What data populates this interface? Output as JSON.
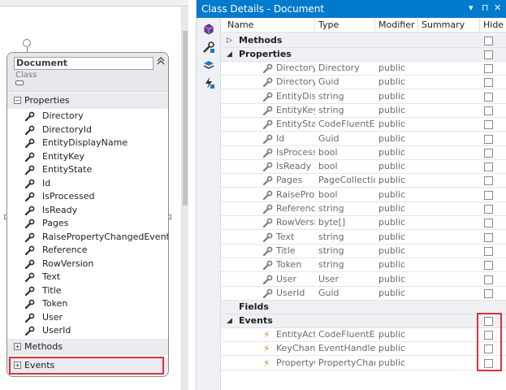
{
  "shape": {
    "class_name": "Document",
    "stereotype": "Class",
    "collapse_glyph": "«",
    "sections": {
      "properties": {
        "label": "Properties",
        "toggle": "−"
      },
      "methods": {
        "label": "Methods",
        "toggle": "+"
      },
      "events": {
        "label": "Events",
        "toggle": "+"
      }
    },
    "properties": [
      "Directory",
      "DirectoryId",
      "EntityDisplayName",
      "EntityKey",
      "EntityState",
      "Id",
      "IsProcessed",
      "IsReady",
      "Pages",
      "RaisePropertyChangedEvents",
      "Reference",
      "RowVersion",
      "Text",
      "Title",
      "Token",
      "User",
      "UserId"
    ],
    "icon": "wrench-icon"
  },
  "details": {
    "title": "Class Details - Document",
    "title_buttons": [
      "▾",
      "⊓",
      "✕"
    ],
    "tool_icons": [
      "new-method-icon",
      "new-property-icon",
      "new-field-icon",
      "new-event-icon"
    ],
    "columns": [
      "Name",
      "Type",
      "Modifier",
      "Summary",
      "Hide"
    ],
    "groups": {
      "methods": "Methods",
      "properties": "Properties",
      "fields": "Fields",
      "events": "Events"
    },
    "properties": [
      {
        "name": "Directory",
        "type": "Directory",
        "modifier": "public"
      },
      {
        "name": "DirectoryId",
        "type": "Guid",
        "modifier": "public"
      },
      {
        "name": "EntityDisplay",
        "type": "string",
        "modifier": "public"
      },
      {
        "name": "EntityKey",
        "type": "string",
        "modifier": "public"
      },
      {
        "name": "EntityState",
        "type": "CodeFluentEnti",
        "modifier": "public"
      },
      {
        "name": "Id",
        "type": "Guid",
        "modifier": "public"
      },
      {
        "name": "IsProcessed",
        "type": "bool",
        "modifier": "public"
      },
      {
        "name": "IsReady",
        "type": "bool",
        "modifier": "public"
      },
      {
        "name": "Pages",
        "type": "PageCollection",
        "modifier": "public"
      },
      {
        "name": "RaisePropert",
        "type": "bool",
        "modifier": "public"
      },
      {
        "name": "Reference",
        "type": "string",
        "modifier": "public"
      },
      {
        "name": "RowVersion",
        "type": "byte[]",
        "modifier": "public"
      },
      {
        "name": "Text",
        "type": "string",
        "modifier": "public"
      },
      {
        "name": "Title",
        "type": "string",
        "modifier": "public"
      },
      {
        "name": "Token",
        "type": "string",
        "modifier": "public"
      },
      {
        "name": "User",
        "type": "User",
        "modifier": "public"
      },
      {
        "name": "UserId",
        "type": "Guid",
        "modifier": "public"
      }
    ],
    "events": [
      {
        "name": "EntityAction",
        "type": "CodeFluentEnti",
        "modifier": "public"
      },
      {
        "name": "KeyChanged",
        "type": "EventHandler<",
        "modifier": "public"
      },
      {
        "name": "PropertyCha",
        "type": "PropertyChange",
        "modifier": "public"
      }
    ],
    "colors": {
      "accent": "#007acc",
      "highlight": "#d8323c",
      "event_icon": "#e8891c"
    }
  }
}
